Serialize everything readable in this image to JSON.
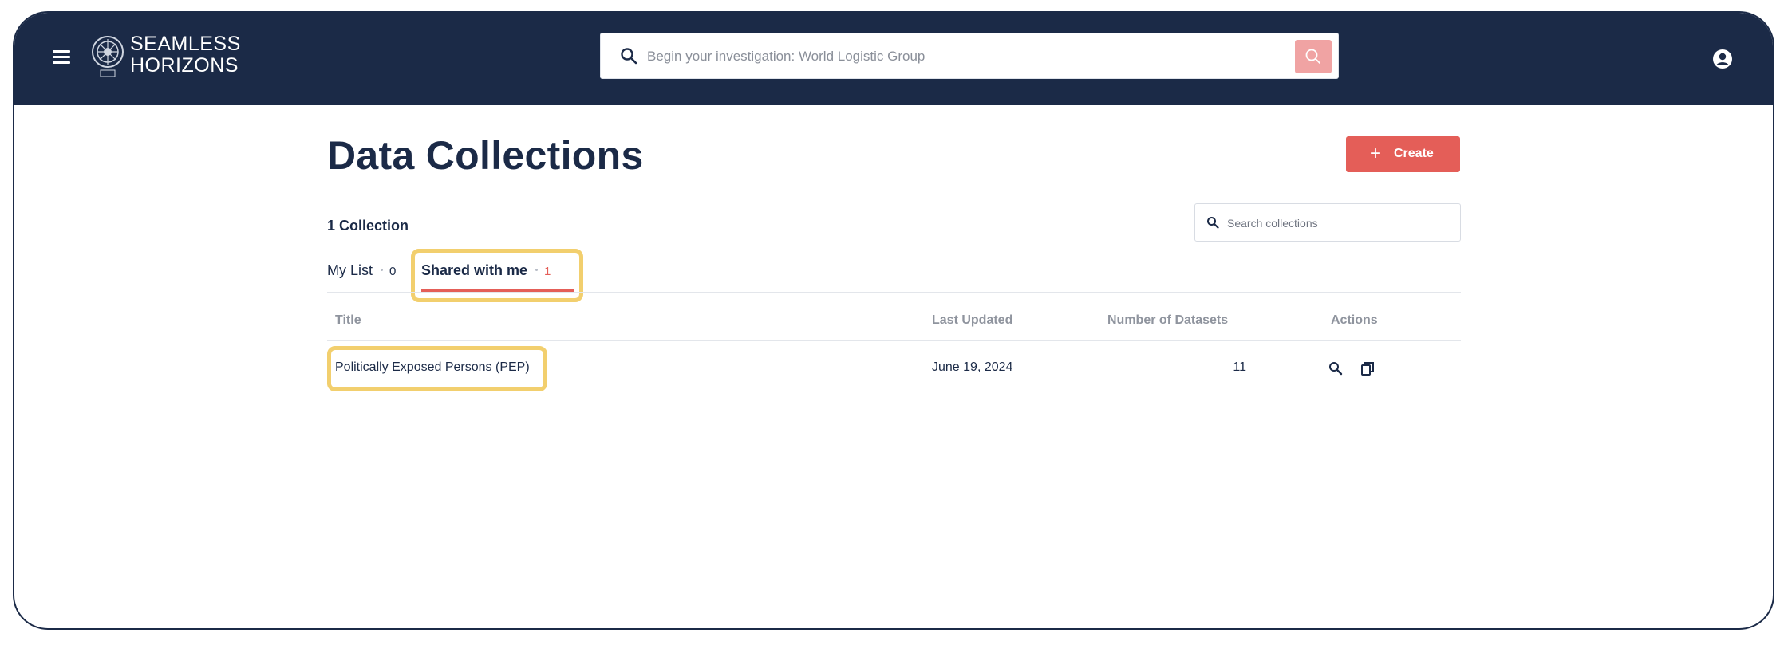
{
  "header": {
    "brand_line1": "SEAMLESS",
    "brand_line2": "HORIZONS",
    "search_placeholder": "Begin your investigation: World Logistic Group",
    "search_value": ""
  },
  "main": {
    "title": "Data Collections",
    "create_label": "Create",
    "create_icon": "+",
    "count_text": "1 Collection",
    "search_placeholder": "Search collections",
    "tabs": [
      {
        "label": "My List",
        "count": "0",
        "active": false
      },
      {
        "label": "Shared with me",
        "count": "1",
        "active": true
      }
    ],
    "table": {
      "columns": [
        "Title",
        "Last Updated",
        "Number of Datasets",
        "Actions"
      ],
      "rows": [
        {
          "title": "Politically Exposed Persons (PEP)",
          "last_updated": "June 19, 2024",
          "datasets": "11",
          "actions": [
            "search-icon",
            "copy-icon"
          ]
        }
      ]
    }
  },
  "colors": {
    "navy": "#1b2a47",
    "accent_red": "#e45e58",
    "highlight": "#f2cf6e",
    "search_button": "#f0a3a3"
  }
}
